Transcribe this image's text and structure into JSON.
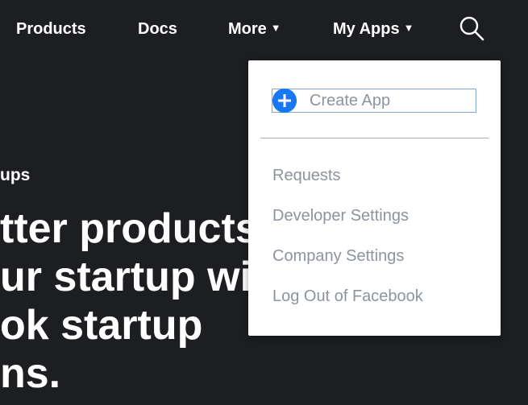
{
  "nav": {
    "products": "Products",
    "docs": "Docs",
    "more": "More",
    "my_apps": "My Apps",
    "caret": "▼",
    "search_icon": "search-icon"
  },
  "hero": {
    "eyebrow": "ups",
    "headline": [
      "tter products",
      "ur startup wi",
      "ok startup",
      "ns."
    ]
  },
  "menu": {
    "create_app": "Create App",
    "items": [
      "Requests",
      "Developer Settings",
      "Company Settings",
      "Log Out of Facebook"
    ]
  },
  "colors": {
    "background": "#1c1e21",
    "menu_background": "#ffffff",
    "accent": "#1877f2",
    "menu_text": "#8d949e"
  }
}
